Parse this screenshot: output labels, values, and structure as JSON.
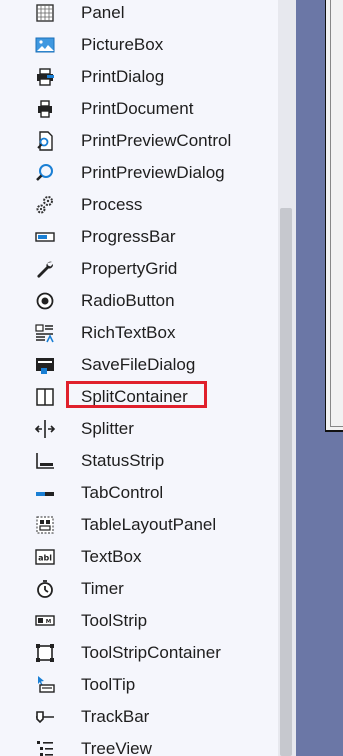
{
  "toolbox": {
    "items": [
      {
        "label": "Panel",
        "icon": "panel-icon"
      },
      {
        "label": "PictureBox",
        "icon": "picturebox-icon"
      },
      {
        "label": "PrintDialog",
        "icon": "printdialog-icon"
      },
      {
        "label": "PrintDocument",
        "icon": "printdocument-icon"
      },
      {
        "label": "PrintPreviewControl",
        "icon": "printpreviewcontrol-icon"
      },
      {
        "label": "PrintPreviewDialog",
        "icon": "printpreviewdialog-icon"
      },
      {
        "label": "Process",
        "icon": "process-icon"
      },
      {
        "label": "ProgressBar",
        "icon": "progressbar-icon"
      },
      {
        "label": "PropertyGrid",
        "icon": "propertygrid-icon"
      },
      {
        "label": "RadioButton",
        "icon": "radiobutton-icon"
      },
      {
        "label": "RichTextBox",
        "icon": "richtextbox-icon"
      },
      {
        "label": "SaveFileDialog",
        "icon": "savefiledialog-icon"
      },
      {
        "label": "SplitContainer",
        "icon": "splitcontainer-icon",
        "highlighted": true
      },
      {
        "label": "Splitter",
        "icon": "splitter-icon"
      },
      {
        "label": "StatusStrip",
        "icon": "statusstrip-icon"
      },
      {
        "label": "TabControl",
        "icon": "tabcontrol-icon"
      },
      {
        "label": "TableLayoutPanel",
        "icon": "tablelayoutpanel-icon"
      },
      {
        "label": "TextBox",
        "icon": "textbox-icon"
      },
      {
        "label": "Timer",
        "icon": "timer-icon"
      },
      {
        "label": "ToolStrip",
        "icon": "toolstrip-icon"
      },
      {
        "label": "ToolStripContainer",
        "icon": "toolstripcontainer-icon"
      },
      {
        "label": "ToolTip",
        "icon": "tooltip-icon"
      },
      {
        "label": "TrackBar",
        "icon": "trackbar-icon"
      },
      {
        "label": "TreeView",
        "icon": "treeview-icon"
      }
    ]
  },
  "colors": {
    "highlight_border": "#e0202c",
    "icon_dark": "#212121",
    "icon_blue": "#1a7fd4",
    "background": "#f5f6fc"
  }
}
